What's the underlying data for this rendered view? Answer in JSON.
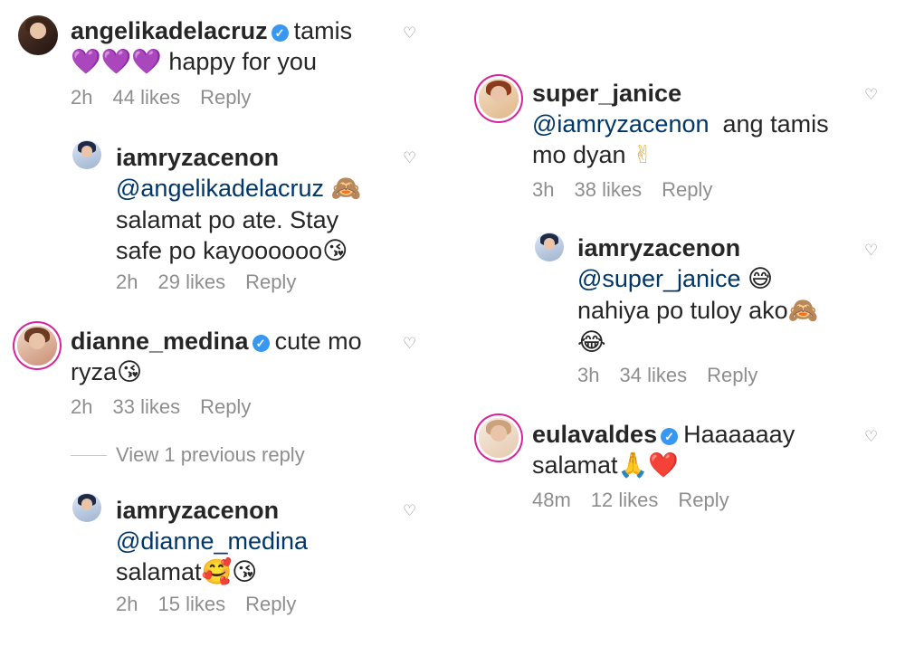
{
  "comments": [
    {
      "username": "angelikadelacruz",
      "verified": true,
      "text": "tamis",
      "line2_emoji": "💜💜💜",
      "line2_text": " happy for you",
      "time": "2h",
      "likes": "44 likes",
      "reply": "Reply"
    },
    {
      "username": "iamryzacenon",
      "mention": "@angelikadelacruz",
      "emoji_a": "🙈",
      "line2": "salamat po ate. Stay",
      "line3": "safe po kayoooooo",
      "emoji_b": "😘",
      "time": "2h",
      "likes": "29 likes",
      "reply": "Reply"
    },
    {
      "username": "dianne_medina",
      "verified": true,
      "text": "cute mo",
      "line2": "ryza",
      "emoji_a": "😘",
      "time": "2h",
      "likes": "33 likes",
      "reply": "Reply"
    },
    {
      "username": "iamryzacenon",
      "mention": "@dianne_medina",
      "line2": "salamat",
      "emoji_a": "🥰😘",
      "time": "2h",
      "likes": "15 likes",
      "reply": "Reply"
    },
    {
      "username": "super_janice",
      "mention": "@iamryzacenon",
      "text": "ang tamis",
      "line2": "mo dyan",
      "emoji_a": "✌",
      "time": "3h",
      "likes": "38 likes",
      "reply": "Reply"
    },
    {
      "username": "iamryzacenon",
      "mention": "@super_janice",
      "emoji_a": "😅",
      "line2": "nahiya po tuloy ako",
      "emoji_b": "🙈",
      "emoji_c": "😂",
      "time": "3h",
      "likes": "34 likes",
      "reply": "Reply"
    },
    {
      "username": "eulavaldes",
      "verified": true,
      "text": "Haaaaaay",
      "line2": "salamat",
      "emoji_a": "🙏❤️",
      "time": "48m",
      "likes": "12 likes",
      "reply": "Reply"
    }
  ],
  "view_previous": "View 1 previous reply",
  "icons": {
    "heart": "heart-outline-icon",
    "verified": "verified-badge-icon"
  }
}
